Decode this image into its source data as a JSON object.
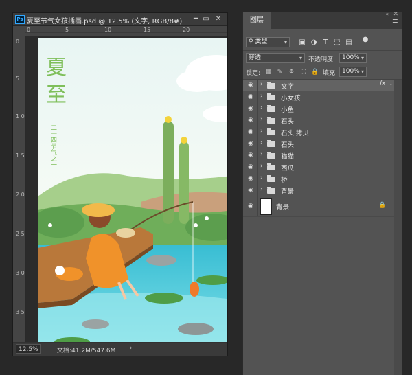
{
  "document": {
    "title": "夏至节气女孩插画.psd @ 12.5% (文字, RGB/8#)",
    "app_badge": "Ps",
    "window_buttons": {
      "minimize": "━",
      "restore": "▭",
      "close": "✕"
    },
    "rulers": {
      "top_labels": [
        "0",
        "5",
        "10",
        "15",
        "20"
      ],
      "left_labels": [
        "0",
        "5",
        "1 0",
        "1 5",
        "2 0",
        "2 5",
        "3 0",
        "3 5"
      ]
    },
    "artwork": {
      "title_chars": [
        "夏",
        "至"
      ],
      "subtitle_vertical": "二十四节气之一"
    },
    "status": {
      "zoom": "12.5%",
      "doc_info": "文档:41.2M/547.6M",
      "arrow": "›"
    }
  },
  "layers_panel": {
    "tab_label": "图层",
    "collapse_label": "«",
    "close_label": "✕",
    "menu_icon": "≡",
    "filter": {
      "label": "类型",
      "search_icon": "⚲"
    },
    "filter_icons": [
      "image-filter-icon",
      "adjustment-filter-icon",
      "type-filter-icon",
      "shape-filter-icon",
      "smart-object-filter-icon",
      "filter-toggle-icon"
    ],
    "blend_mode": "穿透",
    "opacity": {
      "label": "不透明度:",
      "value": "100%"
    },
    "lock": {
      "label": "锁定:"
    },
    "fill": {
      "label": "填充:",
      "value": "100%"
    },
    "layers": [
      {
        "name": "文字",
        "type": "group",
        "selected": true,
        "fx": "fx"
      },
      {
        "name": "小女孩",
        "type": "group"
      },
      {
        "name": "小鱼",
        "type": "group"
      },
      {
        "name": "石头",
        "type": "group"
      },
      {
        "name": "石头 拷贝",
        "type": "group"
      },
      {
        "name": "石头",
        "type": "group"
      },
      {
        "name": "猫猫",
        "type": "group"
      },
      {
        "name": "西瓜",
        "type": "group"
      },
      {
        "name": "桥",
        "type": "group"
      },
      {
        "name": "背景",
        "type": "group"
      },
      {
        "name": "背景",
        "type": "background",
        "locked": true
      }
    ]
  },
  "colors": {
    "accent_title_green": "#7fbf5a",
    "water": "#4fc8d9",
    "dress": "#f0922a"
  }
}
